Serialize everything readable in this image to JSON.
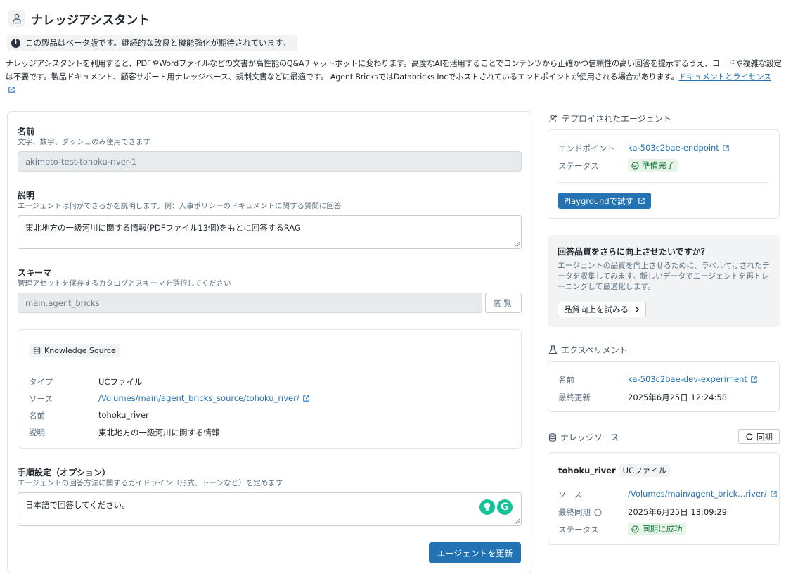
{
  "header": {
    "title": "ナレッジアシスタント",
    "icon": "agent-icon"
  },
  "beta_notice": "この製品はベータ版です。継続的な改良と機能強化が期待されています。",
  "intro": {
    "text": "ナレッジアシスタントを利用すると、PDFやWordファイルなどの文書が高性能のQ&Aチャットボットに変わります。高度なAIを活用することでコンテンツから正確かつ信頼性の高い回答を提示するうえ、コードや複雑な設定は不要です。製品ドキュメント、顧客サポート用ナレッジベース、規制文書などに最適です。 Agent BricksではDatabricks Incでホストされているエンドポイントが使用される場合があります。",
    "link_label": "ドキュメントとライセンス"
  },
  "form": {
    "name": {
      "label": "名前",
      "hint": "文字、数字、ダッシュのみ使用できます",
      "value": "akimoto-test-tohoku-river-1"
    },
    "description": {
      "label": "説明",
      "hint": "エージェントは何ができるかを説明します。例：人事ポリシーのドキュメントに関する質問に回答",
      "value": "東北地方の一級河川に関する情報(PDFファイル13個)をもとに回答するRAG"
    },
    "schema": {
      "label": "スキーマ",
      "hint": "管理アセットを保存するカタログとスキーマを選択してください",
      "value": "main.agent_bricks",
      "browse_label": "閲覧"
    },
    "knowledge_source": {
      "badge": "Knowledge Source",
      "rows": [
        {
          "key": "タイプ",
          "value": "UCファイル"
        },
        {
          "key": "ソース",
          "value": "/Volumes/main/agent_bricks_source/tohoku_river/"
        },
        {
          "key": "名前",
          "value": "tohoku_river"
        },
        {
          "key": "説明",
          "value": "東北地方の一級河川に関する情報"
        }
      ]
    },
    "instructions": {
      "label": "手順設定（オプション）",
      "hint": "エージェントの回答方法に関するガイドライン（形式、トーンなど）を定めます",
      "value": "日本語で回答してください。"
    },
    "update_button": "エージェントを更新"
  },
  "deployed": {
    "title": "デプロイされたエージェント",
    "endpoint_key": "エンドポイント",
    "endpoint_value": "ka-503c2bae-endpoint",
    "status_key": "ステータス",
    "status_value": "準備完了",
    "playground_button": "Playgroundで試す"
  },
  "quality": {
    "title": "回答品質をさらに向上させたいですか？",
    "text": "エージェントの品質を向上させるために、ラベル付けされたデータを収集してみます。新しいデータでエージェントを再トレーニングして最適化します。",
    "button": "品質向上を試みる"
  },
  "experiment": {
    "title": "エクスペリメント",
    "name_key": "名前",
    "name_value": "ka-503c2bae-dev-experiment",
    "updated_key": "最終更新",
    "updated_value": "2025年6月25日 12:24:58"
  },
  "knowledge": {
    "title": "ナレッジソース",
    "sync_button": "同期",
    "source_name": "tohoku_river",
    "source_type": "UCファイル",
    "source_key": "ソース",
    "source_value": "/Volumes/main/agent_brick...river/",
    "synced_key": "最終同期",
    "synced_value": "2025年6月25日 13:09:29",
    "status_key": "ステータス",
    "status_value": "同期に成功"
  },
  "colors": {
    "accent": "#2272b4",
    "success_bg": "#e6f4ea",
    "success_text": "#1a7a3c",
    "grammarly": "#15c39a"
  }
}
